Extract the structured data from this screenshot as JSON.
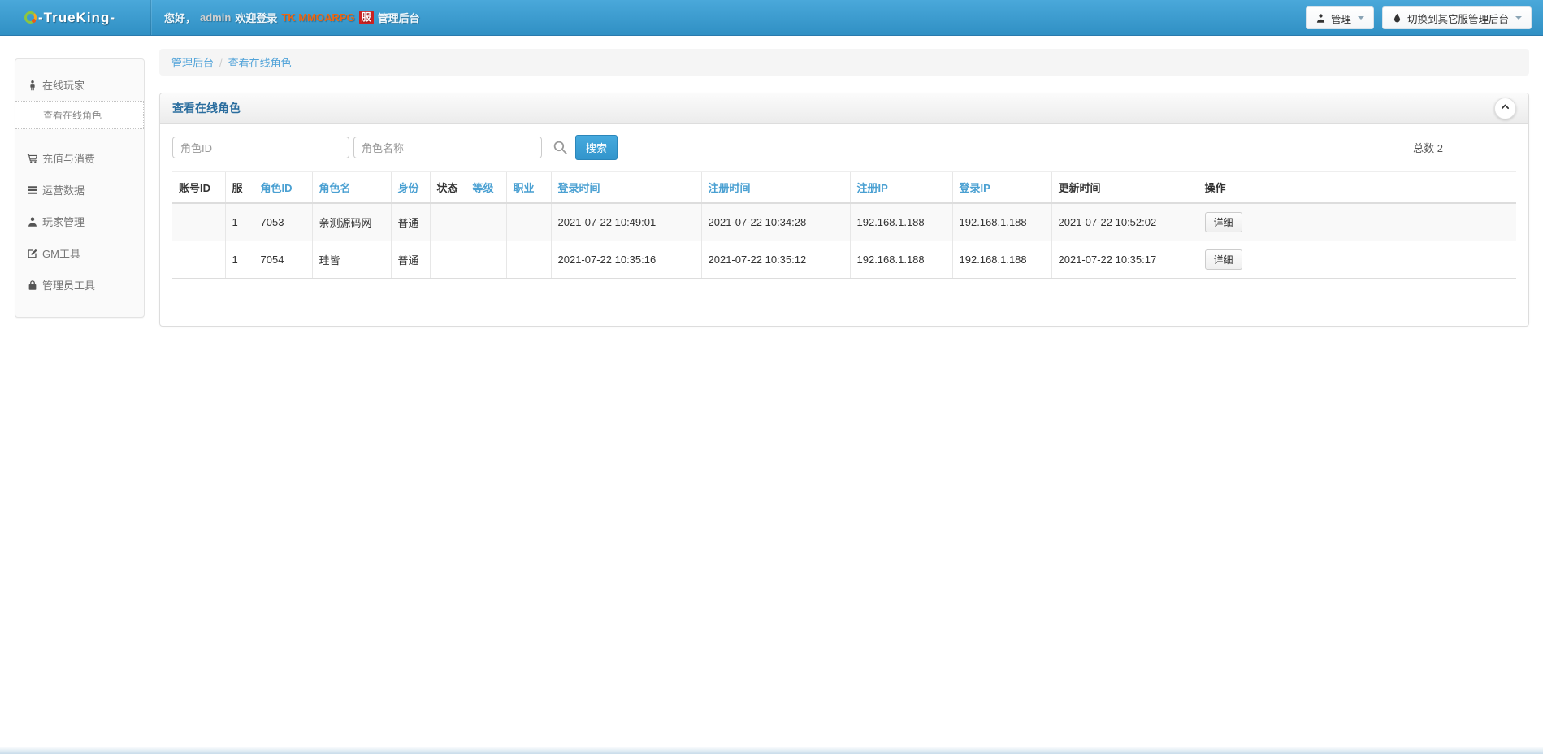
{
  "navbar": {
    "logo_text": "-TrueKing-",
    "welcome_prefix": "您好，",
    "username": "admin",
    "welcome_middle": "欢迎登录",
    "game_name": "TK MMOARPG",
    "server_badge": "服",
    "welcome_suffix": "管理后台",
    "admin_button": "管理",
    "switch_button": "切换到其它服管理后台"
  },
  "sidebar": {
    "groups": [
      {
        "label": "在线玩家",
        "icon": "male-icon"
      },
      {
        "label": "充值与消费",
        "icon": "cart-icon"
      },
      {
        "label": "运营数据",
        "icon": "list-icon"
      },
      {
        "label": "玩家管理",
        "icon": "user-icon"
      },
      {
        "label": "GM工具",
        "icon": "edit-icon"
      },
      {
        "label": "管理员工具",
        "icon": "lock-icon"
      }
    ],
    "active_sub_item": "查看在线角色"
  },
  "breadcrumb": {
    "root": "管理后台",
    "separator": "/",
    "current": "查看在线角色"
  },
  "panel": {
    "title": "查看在线角色"
  },
  "search": {
    "role_id_label": "角色ID",
    "role_name_label": "角色名称",
    "search_button": "搜索",
    "total_label": "总数",
    "total_value": "2"
  },
  "table": {
    "columns": [
      {
        "label": "账号ID",
        "sortable": false
      },
      {
        "label": "服",
        "sortable": false
      },
      {
        "label": "角色ID",
        "sortable": true
      },
      {
        "label": "角色名",
        "sortable": true
      },
      {
        "label": "身份",
        "sortable": true
      },
      {
        "label": "状态",
        "sortable": false
      },
      {
        "label": "等级",
        "sortable": true
      },
      {
        "label": "职业",
        "sortable": true
      },
      {
        "label": "登录时间",
        "sortable": true
      },
      {
        "label": "注册时间",
        "sortable": true
      },
      {
        "label": "注册IP",
        "sortable": true
      },
      {
        "label": "登录IP",
        "sortable": true
      },
      {
        "label": "更新时间",
        "sortable": false
      },
      {
        "label": "操作",
        "sortable": false
      }
    ],
    "rows": [
      {
        "cells": [
          "",
          "1",
          "7053",
          "亲测源码网",
          "普通",
          "",
          "",
          "",
          "2021-07-22 10:49:01",
          "2021-07-22 10:34:28",
          "192.168.1.188",
          "192.168.1.188",
          "2021-07-22 10:52:02"
        ],
        "action": "详细"
      },
      {
        "cells": [
          "",
          "1",
          "7054",
          "珪皆",
          "普通",
          "",
          "",
          "",
          "2021-07-22 10:35:16",
          "2021-07-22 10:35:12",
          "192.168.1.188",
          "192.168.1.188",
          "2021-07-22 10:35:17"
        ],
        "action": "详细"
      }
    ]
  },
  "colors": {
    "navbar_blue": "#3b9ad0",
    "accent_blue": "#3aa2db",
    "link_blue": "#53a4d9",
    "panel_title_blue": "#2a6d9e",
    "badge_red": "#cc2222",
    "game_orange": "#ee6611"
  }
}
